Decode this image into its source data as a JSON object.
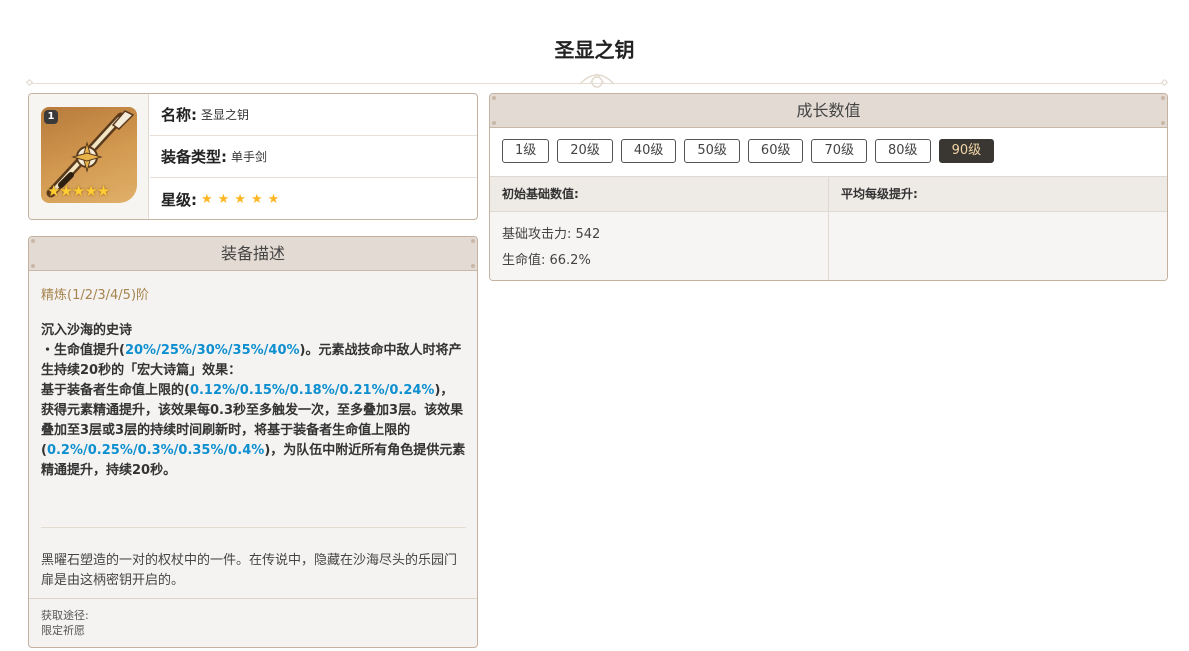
{
  "page": {
    "title": "圣显之钥"
  },
  "info": {
    "name_key": "名称:",
    "name_val": "圣显之钥",
    "type_key": "装备类型:",
    "type_val": "单手剑",
    "rarity_key": "星级:",
    "rarity_stars": "★★★★★",
    "icon_refine": "1",
    "icon_stars": "★★★★★",
    "rarity": 5
  },
  "description": {
    "header": "装备描述",
    "refine_line": "精炼(1/2/3/4/5)阶",
    "passive_name": "沉入沙海的史诗",
    "p1": "・生命值提升(",
    "v1": "20%/25%/30%/35%/40%",
    "p2": ")。元素战技命中敌人时将产生持续20秒的「宏大诗篇」效果：",
    "p3": "基于装备者生命值上限的(",
    "v2": "0.12%/0.15%/0.18%/0.21%/0.24%",
    "p4": ")，获得元素精通提升，该效果每0.3秒至多触发一次，至多叠加3层。该效果叠加至3层或3层的持续时间刷新时，将基于装备者生命值上限的(",
    "v3": "0.2%/0.25%/0.3%/0.35%/0.4%",
    "p5": ")，为队伍中附近所有角色提供元素精通提升，持续20秒。",
    "flavor": "黑曜石塑造的一对的权杖中的一件。在传说中，隐藏在沙海尽头的乐园门扉是由这柄密钥开启的。",
    "source_label": "获取途径:",
    "source_value": "限定祈愿"
  },
  "growth": {
    "header": "成长数值",
    "levels": [
      "1级",
      "20级",
      "40级",
      "50级",
      "60级",
      "70级",
      "80级",
      "90级"
    ],
    "active_level": "90级",
    "col_base": "初始基础数值:",
    "col_per_level": "平均每级提升:",
    "stat1": "基础攻击力: 542",
    "stat2": "生命值: 66.2%"
  },
  "colors": {
    "highlight": "#0d8fd0",
    "refine": "#a6844e",
    "active_btn_bg": "#3a3632",
    "active_btn_text": "#f1d7a6",
    "star": "#ffb623"
  }
}
